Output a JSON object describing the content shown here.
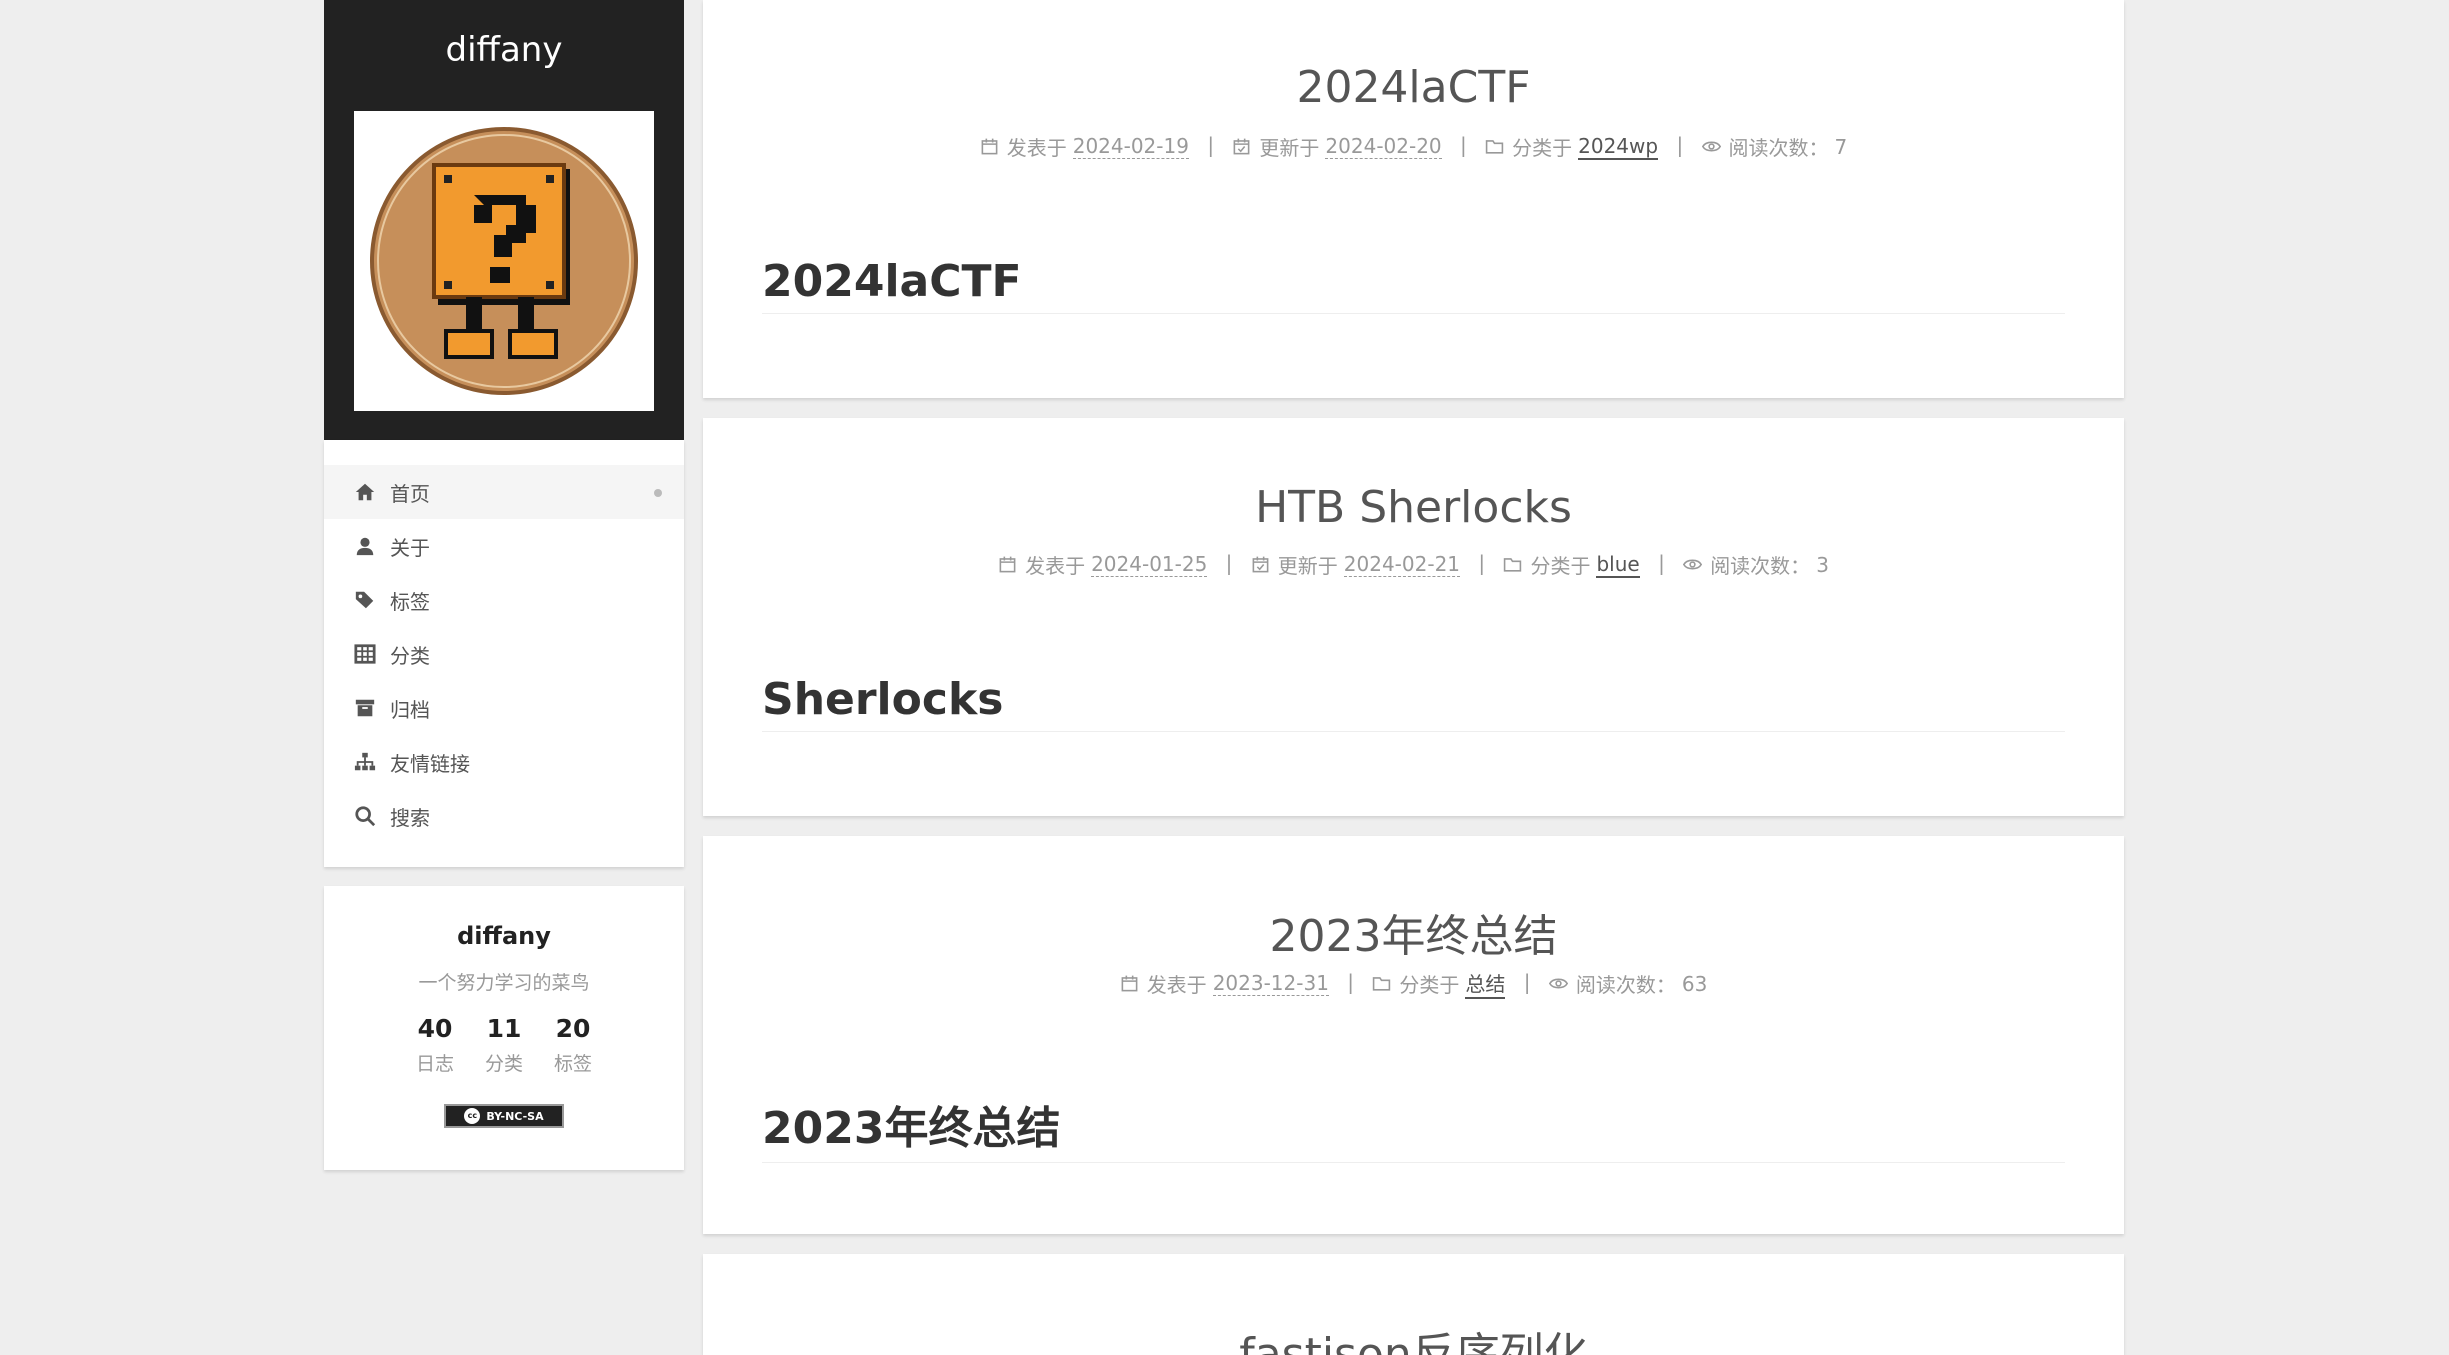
{
  "site": {
    "title": "diffany"
  },
  "menu": [
    {
      "label": "首页",
      "icon": "home-icon",
      "active": true
    },
    {
      "label": "关于",
      "icon": "user-icon"
    },
    {
      "label": "标签",
      "icon": "tags-icon"
    },
    {
      "label": "分类",
      "icon": "th-icon"
    },
    {
      "label": "归档",
      "icon": "archive-icon"
    },
    {
      "label": "友情链接",
      "icon": "sitemap-icon"
    },
    {
      "label": "搜索",
      "icon": "search-icon"
    }
  ],
  "overview": {
    "name": "diffany",
    "description": "一个努力学习的菜鸟",
    "stats": [
      {
        "count": "40",
        "label": "日志"
      },
      {
        "count": "11",
        "label": "分类"
      },
      {
        "count": "20",
        "label": "标签"
      }
    ],
    "license": "BY-NC-SA",
    "license_cc": "cc"
  },
  "posts": [
    {
      "title": "2024laCTF",
      "posted_label": "发表于",
      "posted": "2024-02-19",
      "updated_label": "更新于",
      "updated": "2024-02-20",
      "category_label": "分类于",
      "category": "2024wp",
      "views_label": "阅读次数：",
      "views": "7",
      "heading": "2024laCTF"
    },
    {
      "title": "HTB Sherlocks",
      "posted_label": "发表于",
      "posted": "2024-01-25",
      "updated_label": "更新于",
      "updated": "2024-02-21",
      "category_label": "分类于",
      "category": "blue",
      "views_label": "阅读次数：",
      "views": "3",
      "heading": "Sherlocks"
    },
    {
      "title": "2023年终总结",
      "posted_label": "发表于",
      "posted": "2023-12-31",
      "category_label": "分类于",
      "category": "总结",
      "views_label": "阅读次数：",
      "views": "63",
      "heading": "2023年终总结"
    },
    {
      "title": "fastjson反序列化"
    }
  ],
  "meta_separator": "|"
}
